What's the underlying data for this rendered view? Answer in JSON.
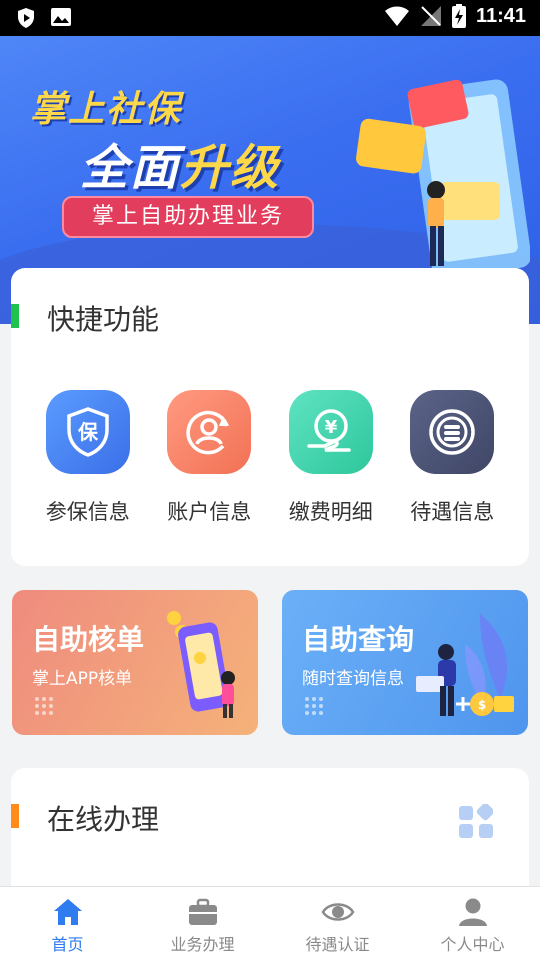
{
  "status_bar": {
    "time": "11:41"
  },
  "banner": {
    "title_line1": "掌上社保",
    "title_line2_a": "全面",
    "title_line2_b": "升级",
    "pill_text": "掌上自助办理业务"
  },
  "quick": {
    "title": "快捷功能",
    "accent": "#1fc24b",
    "items": [
      {
        "label": "参保信息",
        "icon": "shield-icon",
        "color_from": "#5a9cff",
        "color_to": "#3b6fe8"
      },
      {
        "label": "账户信息",
        "icon": "user-refresh-icon",
        "color_from": "#ff9a80",
        "color_to": "#f27155"
      },
      {
        "label": "缴费明细",
        "icon": "yen-hand-icon",
        "color_from": "#5fe3c1",
        "color_to": "#2ec79c"
      },
      {
        "label": "待遇信息",
        "icon": "coin-stack-icon",
        "color_from": "#5b6488",
        "color_to": "#3f4666"
      }
    ]
  },
  "promos": [
    {
      "title": "自助核单",
      "subtitle": "掌上APP核单"
    },
    {
      "title": "自助查询",
      "subtitle": "随时查询信息"
    }
  ],
  "online": {
    "title": "在线办理",
    "accent": "#ff8c1a"
  },
  "bottom_nav": {
    "active_color": "#2f7bf0",
    "items": [
      {
        "label": "首页",
        "icon": "home-icon"
      },
      {
        "label": "业务办理",
        "icon": "briefcase-icon"
      },
      {
        "label": "待遇认证",
        "icon": "eye-icon"
      },
      {
        "label": "个人中心",
        "icon": "person-icon"
      }
    ]
  }
}
